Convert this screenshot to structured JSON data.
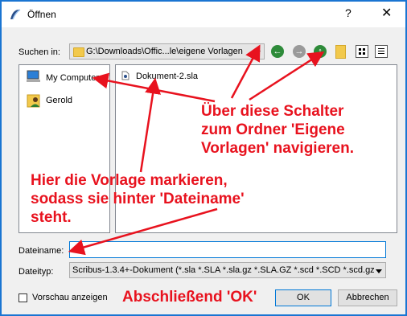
{
  "window": {
    "title": "Öffnen",
    "help": "?",
    "close": "✕"
  },
  "lookin": {
    "label": "Suchen in:",
    "path": "G:\\Downloads\\Offic...le\\eigene Vorlagen"
  },
  "toolbar": {
    "back_icon": "arrow-left-icon",
    "forward_icon": "arrow-right-icon",
    "up_icon": "arrow-up-icon",
    "new_folder_icon": "new-folder-icon",
    "list_view_icon": "list-view-icon",
    "detail_view_icon": "detail-view-icon"
  },
  "sidebar": {
    "items": [
      {
        "label": "My Computer"
      },
      {
        "label": "Gerold"
      }
    ]
  },
  "files": [
    {
      "label": "Dokument-2.sla"
    }
  ],
  "filename": {
    "label": "Dateiname:",
    "value": ""
  },
  "filetype": {
    "label": "Dateityp:",
    "value": "Scribus-1.3.4+-Dokument (*.sla *.SLA *.sla.gz *.SLA.GZ *.scd *.SCD *.scd.gz"
  },
  "preview": {
    "label": "Vorschau anzeigen"
  },
  "buttons": {
    "ok": "OK",
    "cancel": "Abbrechen"
  },
  "annotations": {
    "nav_note": "Über diese Schalter\nzum Ordner 'Eigene\nVorlagen' navigieren.",
    "select_note": "Hier die Vorlage markieren,\nsodass sie hinter 'Dateiname'\nsteht.",
    "final_note": "Abschließend 'OK'"
  },
  "colors": {
    "annotation": "#e8121e",
    "accent": "#1a75d2"
  }
}
